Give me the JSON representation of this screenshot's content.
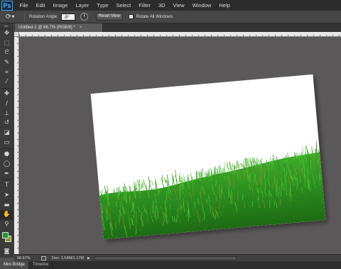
{
  "app": {
    "logo_text": "Ps"
  },
  "menu": [
    "File",
    "Edit",
    "Image",
    "Layer",
    "Type",
    "Select",
    "Filter",
    "3D",
    "View",
    "Window",
    "Help"
  ],
  "options_bar": {
    "tool_icon": "rotate-view-icon",
    "rotation_label": "Rotation Angle:",
    "rotation_value": "-5°",
    "reset_label": "Reset View",
    "rotate_all_label": "Rotate All Windows",
    "rotate_all_checked": false
  },
  "document": {
    "tab_title": "Untitled-1 @ 66.7% (RGB/8) *",
    "close_glyph": "×",
    "rotation_degrees": -5
  },
  "toolbar": {
    "tools": [
      {
        "icon": "move-icon",
        "glyph": "✥"
      },
      {
        "icon": "marquee-icon",
        "glyph": "⬚"
      },
      {
        "icon": "lasso-icon",
        "glyph": "ᘓ"
      },
      {
        "icon": "quick-select-icon",
        "glyph": "✎"
      },
      {
        "icon": "crop-icon",
        "glyph": "⌗"
      },
      {
        "icon": "eyedropper-icon",
        "glyph": "⁄"
      },
      {
        "icon": "healing-brush-icon",
        "glyph": "✚"
      },
      {
        "icon": "brush-icon",
        "glyph": "∕"
      },
      {
        "icon": "clone-stamp-icon",
        "glyph": "⊥"
      },
      {
        "icon": "history-brush-icon",
        "glyph": "↺"
      },
      {
        "icon": "eraser-icon",
        "glyph": "◪"
      },
      {
        "icon": "gradient-icon",
        "glyph": "▭"
      },
      {
        "icon": "blur-icon",
        "glyph": "●"
      },
      {
        "icon": "dodge-icon",
        "glyph": "◯"
      },
      {
        "icon": "pen-icon",
        "glyph": "✒"
      },
      {
        "icon": "type-icon",
        "glyph": "T"
      },
      {
        "icon": "path-select-icon",
        "glyph": "➤"
      },
      {
        "icon": "shape-icon",
        "glyph": "▬"
      },
      {
        "icon": "hand-icon",
        "glyph": "✋",
        "active": true
      },
      {
        "icon": "zoom-icon",
        "glyph": "⚲"
      }
    ],
    "colors": {
      "foreground": "#1d9a2c",
      "background": "#8a9a22"
    },
    "quick_mask_glyph": "◙"
  },
  "status": {
    "zoom": "66.67%",
    "doc_info": "Doc: 1.54M/1.17M",
    "arrow_glyph": "▶"
  },
  "panels": [
    "Mini Bridge",
    "Timeline"
  ],
  "colors": {
    "ui_dark": "#2c2c2c",
    "pasteboard": "#5a5858",
    "grass_dark": "#1e6a14",
    "grass_light": "#3fae2a"
  }
}
